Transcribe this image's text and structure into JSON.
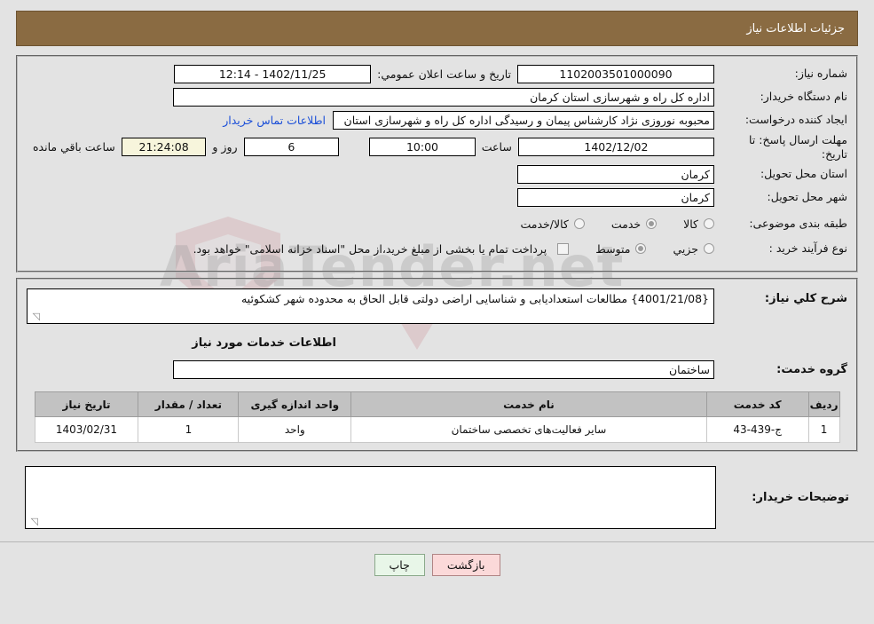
{
  "header": {
    "title": "جزئیات اطلاعات نیاز",
    "bar_color": "#8a6b42"
  },
  "watermark": {
    "text": "AriaTender.net"
  },
  "form": {
    "need_number": {
      "label": "شماره نیاز:",
      "value": "1102003501000090"
    },
    "public_announce": {
      "label": "تاریخ و ساعت اعلان عمومي:",
      "value": "1402/11/25 - 12:14"
    },
    "buyer_org": {
      "label": "نام دستگاه خریدار:",
      "value": "اداره کل راه و شهرسازی استان کرمان"
    },
    "request_creator": {
      "label": "ایجاد کننده درخواست:",
      "value": "محبوبه نوروزی نژاد کارشناس پیمان و رسیدگی اداره کل راه و شهرسازی استان",
      "contact_link": "اطلاعات تماس خریدار"
    },
    "deadline": {
      "label": "مهلت ارسال پاسخ: تا تاریخ:",
      "date": "1402/12/02",
      "hour_label": "ساعت",
      "hour_value": "10:00",
      "days_value": "6",
      "days_label": "روز و",
      "clock_value": "21:24:08",
      "remaining_label": "ساعت باقي مانده"
    },
    "delivery_province": {
      "label": "استان محل تحویل:",
      "value": "کرمان"
    },
    "delivery_city": {
      "label": "شهر محل تحویل:",
      "value": "کرمان"
    },
    "category": {
      "label": "طبقه بندی موضوعی:",
      "options": [
        {
          "label": "کالا",
          "selected": false
        },
        {
          "label": "خدمت",
          "selected": true
        },
        {
          "label": "کالا/خدمت",
          "selected": false
        }
      ]
    },
    "purchase_type": {
      "label": "نوع فرآیند خرید :",
      "options": [
        {
          "label": "جزیي",
          "selected": false
        },
        {
          "label": "متوسط",
          "selected": true
        }
      ],
      "treasury_checkbox_checked": false,
      "treasury_note": "پرداخت تمام یا بخشی از مبلغ خرید،از محل \"اسناد خزانه اسلامی\" خواهد بود."
    }
  },
  "description": {
    "label": "شرح کلي نیاز:",
    "value": "{4001/21/08} مطالعات استعدادیابی و شناسایی اراضی دولتی قابل الحاق به محدوده شهر کشکوئیه"
  },
  "services_section": {
    "heading": "اطلاعات خدمات مورد نیاز",
    "service_group": {
      "label": "گروه خدمت:",
      "value": "ساختمان"
    }
  },
  "needs_table": {
    "headers": [
      "ردیف",
      "کد خدمت",
      "نام خدمت",
      "واحد اندازه گیری",
      "تعداد / مقدار",
      "تاریخ نیاز"
    ],
    "rows": [
      {
        "radif": "1",
        "code": "ج-439-43",
        "name": "سایر فعالیت‌های تخصصی ساختمان",
        "unit": "واحد",
        "qty": "1",
        "date": "1403/02/31"
      }
    ]
  },
  "buyer_notes": {
    "label": "توضیحات خریدار:",
    "value": ""
  },
  "buttons": {
    "print": {
      "label": "چاپ",
      "color": "#e8f6e8"
    },
    "back": {
      "label": "بازگشت",
      "color": "#fbd9d9"
    }
  }
}
